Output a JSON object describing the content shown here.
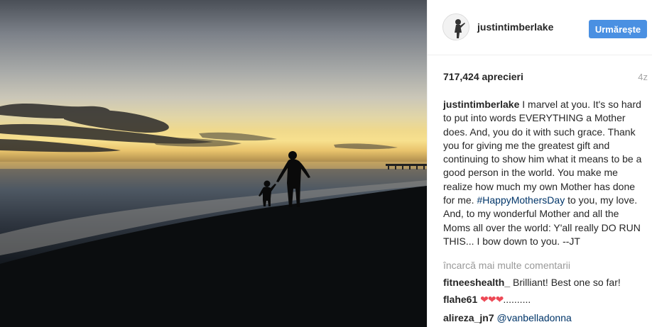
{
  "post": {
    "image_label": "Silhouette of a mother and child walking along the beach at sunset"
  },
  "header": {
    "avatar_icon": "user-avatar-icon",
    "username": "justintimberlake",
    "follow_label": "Urmărește",
    "follow_color": "#4a90e2"
  },
  "stats": {
    "likes": "717,424 aprecieri",
    "age": "4z"
  },
  "caption": {
    "username": "justintimberlake",
    "text_before": " I marvel at you. It's so hard to put into words EVERYTHING a Mother does. And, you do it with such grace. Thank you for giving me the greatest gift and continuing to show him what it means to be a good person in the world. You make me realize how much my own Mother has done for me. ",
    "hashtag": "#HappyMothersDay",
    "text_after": " to you, my love. And, to my wonderful Mother and all the Moms all over the world: Y'all really DO RUN THIS... I bow down to you. --JT"
  },
  "load_more": "încarcă mai multe comentarii",
  "comments": [
    {
      "username": "fitneeshealth_",
      "text": " Brilliant! Best one so far!"
    },
    {
      "username": "flahe61",
      "hearts": "❤❤❤",
      "text": ".........."
    },
    {
      "username": "alireza_jn7",
      "mention": "@vanbelladonna"
    }
  ],
  "colors": {
    "link": "#003569",
    "muted": "#999999",
    "heart": "#ed4956"
  }
}
